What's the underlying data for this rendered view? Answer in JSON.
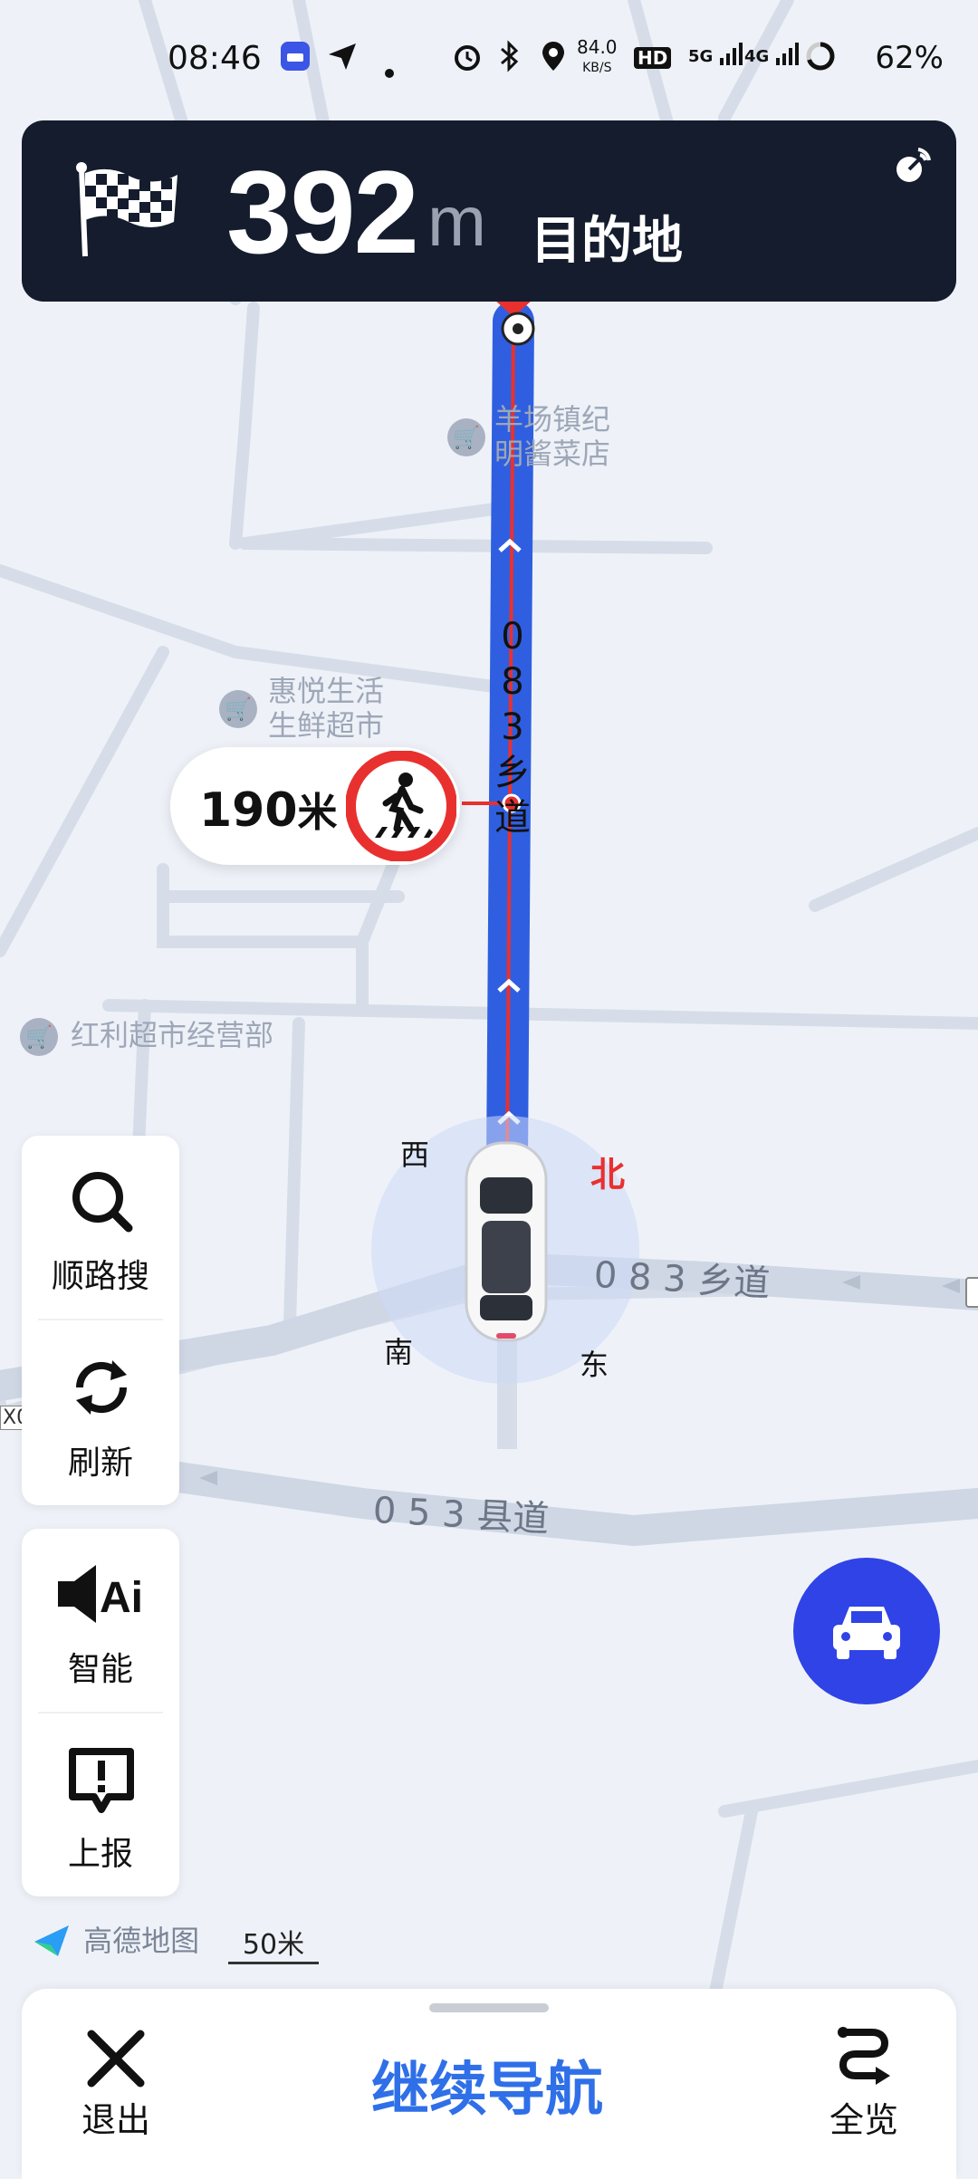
{
  "status_bar": {
    "time": "08:46",
    "network_speed": "84.0",
    "network_speed_unit": "KB/S",
    "hd": "HD",
    "signal_1": "5G",
    "signal_2": "4G",
    "battery": "62%",
    "icons": [
      "car-app-icon",
      "send-icon",
      "dot-icon",
      "alarm-icon",
      "bluetooth-icon",
      "location-icon",
      "hd-icon",
      "signal-icon",
      "signal-icon",
      "battery-icon"
    ]
  },
  "banner": {
    "distance": "392",
    "unit": "m",
    "destination": "目的地",
    "icons": [
      "checkered-flag-icon",
      "gps-signal-icon"
    ]
  },
  "map": {
    "pois": [
      {
        "name_line1": "羊场镇纪",
        "name_line2": "明酱菜店"
      },
      {
        "name_line1": "惠悦生活",
        "name_line2": "生鲜超市"
      },
      {
        "name_line1": "红利超市经营部",
        "name_line2": ""
      }
    ],
    "route_road_chars": [
      "0",
      "8",
      "3",
      "乡",
      "道"
    ],
    "road_083": "0 8 3 乡道",
    "road_053": "0 5 3 县道",
    "compass": {
      "west": "西",
      "north": "北",
      "south": "南",
      "east": "东"
    },
    "edge_label": "X0"
  },
  "callout": {
    "distance": "190",
    "unit": "米",
    "icon": "pedestrian-crossing-sign-icon"
  },
  "side_panel": {
    "search": "顺路搜",
    "refresh": "刷新",
    "smart": "智能",
    "report": "上报"
  },
  "brand": "高德地图",
  "scale": "50米",
  "bottom_bar": {
    "exit": "退出",
    "continue": "继续导航",
    "overview": "全览"
  },
  "colors": {
    "route_blue": "#2f5fe0",
    "route_red": "#e8312f",
    "banner_bg": "#141c2e",
    "accent": "#2f6fe8",
    "fab": "#2f43e6"
  }
}
